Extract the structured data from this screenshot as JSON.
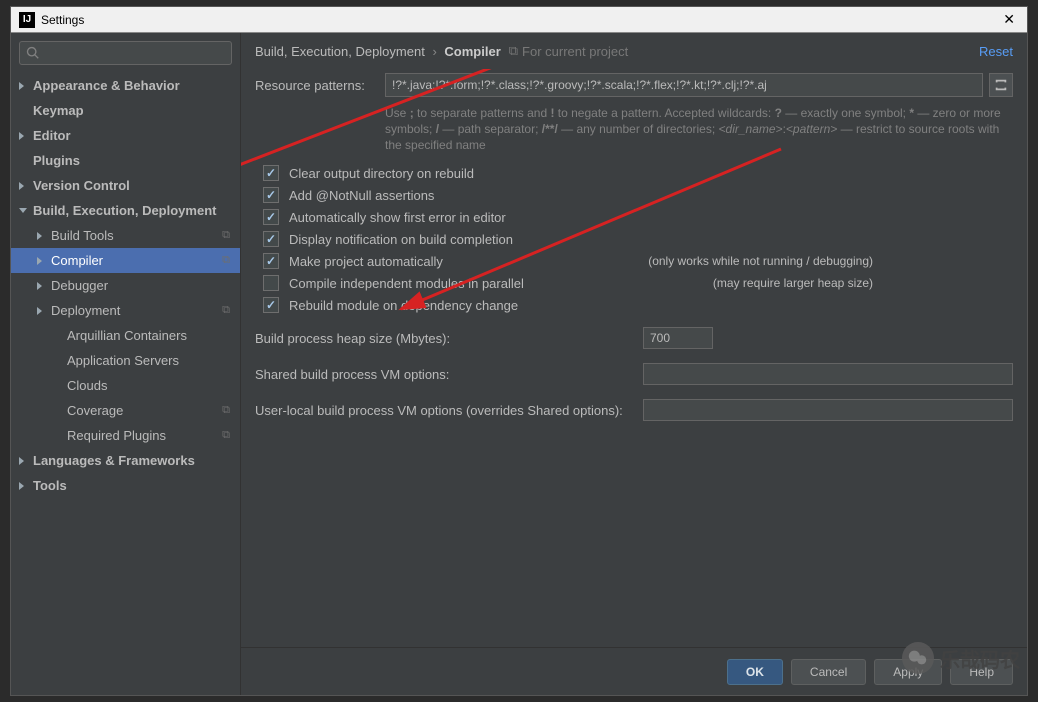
{
  "window": {
    "title": "Settings"
  },
  "search": {
    "placeholder": ""
  },
  "sidebar": {
    "items": [
      {
        "label": "Appearance & Behavior",
        "lvl": 0,
        "arrow": "right",
        "bold": true
      },
      {
        "label": "Keymap",
        "lvl": 0,
        "arrow": "",
        "bold": true
      },
      {
        "label": "Editor",
        "lvl": 0,
        "arrow": "right",
        "bold": true
      },
      {
        "label": "Plugins",
        "lvl": 0,
        "arrow": "",
        "bold": true
      },
      {
        "label": "Version Control",
        "lvl": 0,
        "arrow": "right",
        "bold": true
      },
      {
        "label": "Build, Execution, Deployment",
        "lvl": 0,
        "arrow": "down",
        "bold": true
      },
      {
        "label": "Build Tools",
        "lvl": 1,
        "arrow": "right",
        "bold": false,
        "badge": "⧉"
      },
      {
        "label": "Compiler",
        "lvl": 1,
        "arrow": "right",
        "bold": false,
        "badge": "⧉",
        "selected": true
      },
      {
        "label": "Debugger",
        "lvl": 1,
        "arrow": "right",
        "bold": false
      },
      {
        "label": "Deployment",
        "lvl": 1,
        "arrow": "right",
        "bold": false,
        "badge": "⧉"
      },
      {
        "label": "Arquillian Containers",
        "lvl": 2,
        "arrow": "",
        "bold": false
      },
      {
        "label": "Application Servers",
        "lvl": 2,
        "arrow": "",
        "bold": false
      },
      {
        "label": "Clouds",
        "lvl": 2,
        "arrow": "",
        "bold": false
      },
      {
        "label": "Coverage",
        "lvl": 2,
        "arrow": "",
        "bold": false,
        "badge": "⧉"
      },
      {
        "label": "Required Plugins",
        "lvl": 2,
        "arrow": "",
        "bold": false,
        "badge": "⧉"
      },
      {
        "label": "Languages & Frameworks",
        "lvl": 0,
        "arrow": "right",
        "bold": true
      },
      {
        "label": "Tools",
        "lvl": 0,
        "arrow": "right",
        "bold": true
      }
    ]
  },
  "header": {
    "breadcrumb_parent": "Build, Execution, Deployment",
    "breadcrumb_current": "Compiler",
    "scope": "For current project",
    "reset": "Reset"
  },
  "fields": {
    "resource_patterns_label": "Resource patterns:",
    "resource_patterns_value": "!?*.java;!?*.form;!?*.class;!?*.groovy;!?*.scala;!?*.flex;!?*.kt;!?*.clj;!?*.aj",
    "help_text": "Use ; to separate patterns and ! to negate a pattern. Accepted wildcards: ? — exactly one symbol; * — zero or more symbols; / — path separator; /**/ — any number of directories; <dir_name>: <pattern> — restrict to source roots with the specified name"
  },
  "checkboxes": [
    {
      "label": "Clear output directory on rebuild",
      "checked": true,
      "note": ""
    },
    {
      "label": "Add @NotNull assertions",
      "checked": true,
      "note": ""
    },
    {
      "label": "Automatically show first error in editor",
      "checked": true,
      "note": ""
    },
    {
      "label": "Display notification on build completion",
      "checked": true,
      "note": ""
    },
    {
      "label": "Make project automatically",
      "checked": true,
      "note": "(only works while not running / debugging)"
    },
    {
      "label": "Compile independent modules in parallel",
      "checked": false,
      "note": "(may require larger heap size)"
    },
    {
      "label": "Rebuild module on dependency change",
      "checked": true,
      "note": ""
    }
  ],
  "options": {
    "heap_label": "Build process heap size (Mbytes):",
    "heap_value": "700",
    "shared_label": "Shared build process VM options:",
    "shared_value": "",
    "user_label": "User-local build process VM options (overrides Shared options):",
    "user_value": ""
  },
  "buttons": {
    "ok": "OK",
    "cancel": "Cancel",
    "apply": "Apply",
    "help": "Help"
  },
  "watermark": "乐哉码农"
}
